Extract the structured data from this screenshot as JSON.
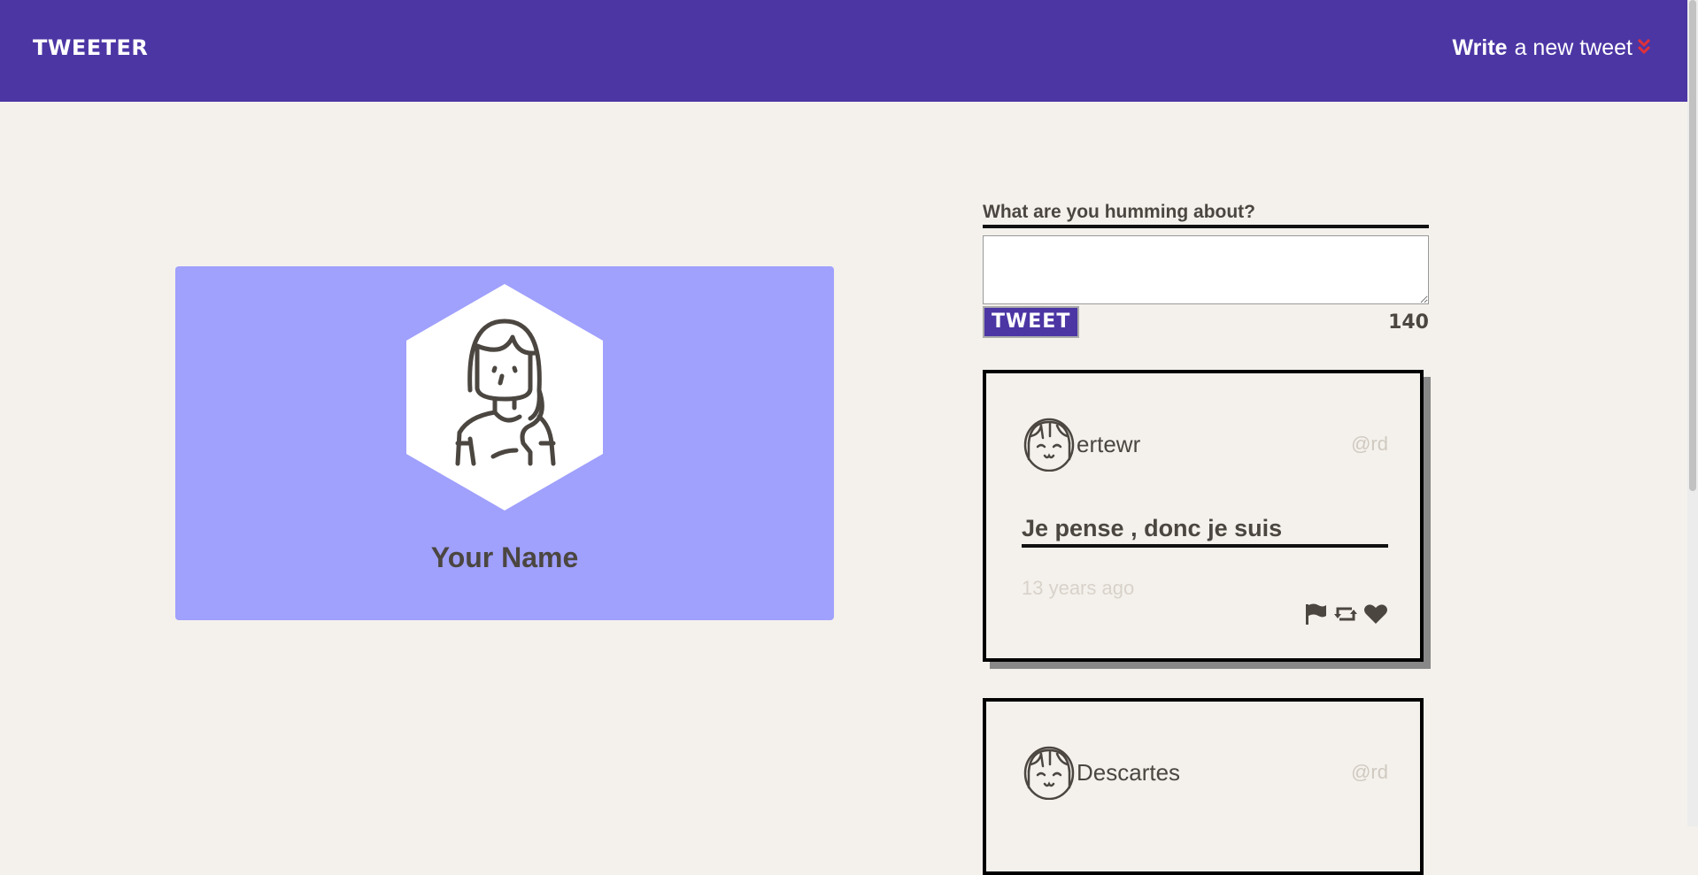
{
  "nav": {
    "logo": "TWEETER",
    "write_bold": "Write",
    "write_rest": "a new tweet",
    "write_icon": "double-chevron-down-icon"
  },
  "profile": {
    "name": "Your Name",
    "avatar_icon": "woman-avatar-icon",
    "background_color": "#a0a0fd"
  },
  "compose": {
    "label": "What are you humming about?",
    "textarea_value": "",
    "button_label": "TWEET",
    "counter": "140"
  },
  "tweets": [
    {
      "name": "ertewr",
      "handle": "@rd",
      "content": "Je pense , donc je suis",
      "time": "13 years ago",
      "avatar_icon": "girl-avatar-icon",
      "actions": [
        "flag-icon",
        "retweet-icon",
        "heart-icon"
      ]
    },
    {
      "name": "Descartes",
      "handle": "@rd",
      "avatar_icon": "girl-avatar-icon"
    }
  ],
  "colors": {
    "accent": "#4c36a4",
    "page_bg": "#f4f1ec",
    "chevron": "#e0303a"
  }
}
